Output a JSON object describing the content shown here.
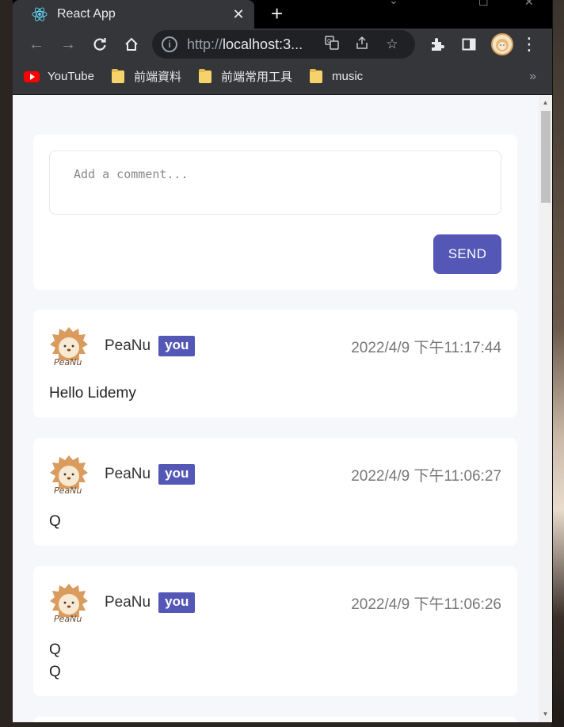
{
  "browser": {
    "tab_title": "React App",
    "url_scheme": "http://",
    "url_host": "localhost:3...",
    "bookmarks": [
      {
        "label": "YouTube",
        "icon": "youtube-icon"
      },
      {
        "label": "前端資料",
        "icon": "folder-icon"
      },
      {
        "label": "前端常用工具",
        "icon": "folder-icon"
      },
      {
        "label": "music",
        "icon": "folder-icon"
      }
    ],
    "bookmarks_overflow": "»"
  },
  "form": {
    "placeholder": "Add a comment...",
    "send_label": "SEND"
  },
  "comments": [
    {
      "username": "PeaNu",
      "badge": "you",
      "time": "2022/4/9 下午11:17:44",
      "body": [
        "Hello Lidemy"
      ]
    },
    {
      "username": "PeaNu",
      "badge": "you",
      "time": "2022/4/9 下午11:06:27",
      "body": [
        "Q"
      ]
    },
    {
      "username": "PeaNu",
      "badge": "you",
      "time": "2022/4/9 下午11:06:26",
      "body": [
        "Q",
        "Q"
      ]
    }
  ],
  "colors": {
    "accent": "#5457b6",
    "page_bg": "#f6f7fb",
    "chrome_dark": "#35363a"
  }
}
